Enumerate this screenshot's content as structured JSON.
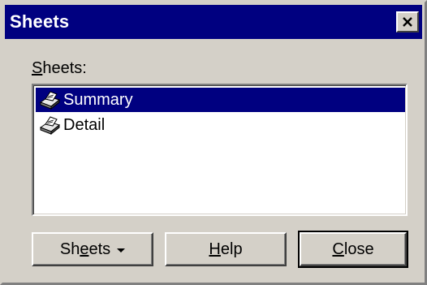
{
  "window": {
    "title": "Sheets"
  },
  "list": {
    "label": "Sheets:",
    "label_access_key": "S",
    "label_rest": "heets:",
    "items": [
      {
        "label": "Summary",
        "selected": true,
        "icon": "printer-sheet-icon"
      },
      {
        "label": "Detail",
        "selected": false,
        "icon": "printer-sheet-icon"
      }
    ]
  },
  "buttons": {
    "sheets": {
      "pre": "Sh",
      "key": "e",
      "post": "ets",
      "full": "Sheets",
      "icon": "dropdown-arrow-icon"
    },
    "help": {
      "pre": "",
      "key": "H",
      "post": "elp",
      "full": "Help"
    },
    "close": {
      "pre": "",
      "key": "C",
      "post": "lose",
      "full": "Close"
    }
  },
  "colors": {
    "titlebar": "#000080",
    "selection": "#000080",
    "face": "#d4d0c8"
  }
}
